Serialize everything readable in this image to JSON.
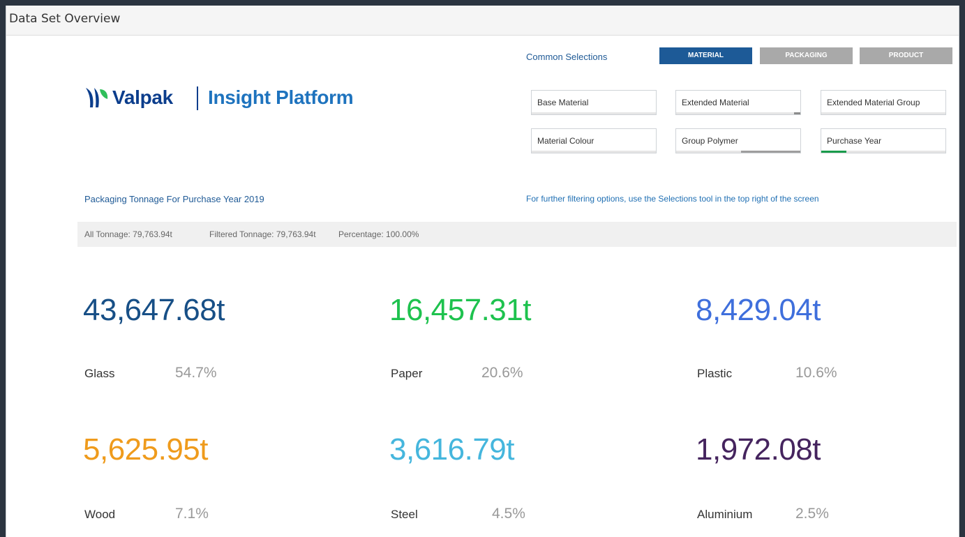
{
  "window": {
    "title": "Data Set Overview"
  },
  "logo": {
    "brand": "Valpak",
    "product": "Insight Platform"
  },
  "common_selections": {
    "label": "Common Selections",
    "buttons": [
      {
        "label": "MATERIAL",
        "active": true
      },
      {
        "label": "PACKAGING",
        "active": false
      },
      {
        "label": "PRODUCT",
        "active": false
      }
    ]
  },
  "filters": [
    {
      "label": "Base Material",
      "fill_fraction": 0,
      "fill_color": "#8c8c8c"
    },
    {
      "label": "Extended Material",
      "fill_fraction": 0.05,
      "fill_color": "#8c8c8c"
    },
    {
      "label": "Extended Material Group",
      "fill_fraction": 0,
      "fill_color": "#8c8c8c"
    },
    {
      "label": "Material Colour",
      "fill_fraction": 0,
      "fill_color": "#8c8c8c"
    },
    {
      "label": "Group Polymer",
      "fill_fraction": 0.48,
      "fill_color": "#9e9e9e"
    },
    {
      "label": "Purchase Year",
      "fill_fraction": 0.2,
      "fill_color": "#1a9c4b"
    }
  ],
  "headline": "Packaging Tonnage For Purchase Year 2019",
  "hint": "For further filtering options, use the Selections tool in the top right of the screen",
  "stats": {
    "all_tonnage": "All Tonnage: 79,763.94t",
    "filtered_tonnage": "Filtered Tonnage: 79,763.94t",
    "percentage": "Percentage: 100.00%"
  },
  "metrics": [
    {
      "value": "43,647.68t",
      "name": "Glass",
      "pct": "54.7%",
      "color": "#174f86"
    },
    {
      "value": "16,457.31t",
      "name": "Paper",
      "pct": "20.6%",
      "color": "#1ec24e"
    },
    {
      "value": "8,429.04t",
      "name": "Plastic",
      "pct": "10.6%",
      "color": "#3f6fdc"
    },
    {
      "value": "5,625.95t",
      "name": "Wood",
      "pct": "7.1%",
      "color": "#ef9b1c"
    },
    {
      "value": "3,616.79t",
      "name": "Steel",
      "pct": "4.5%",
      "color": "#45b6dd"
    },
    {
      "value": "1,972.08t",
      "name": "Aluminium",
      "pct": "2.5%",
      "color": "#45245e"
    }
  ]
}
